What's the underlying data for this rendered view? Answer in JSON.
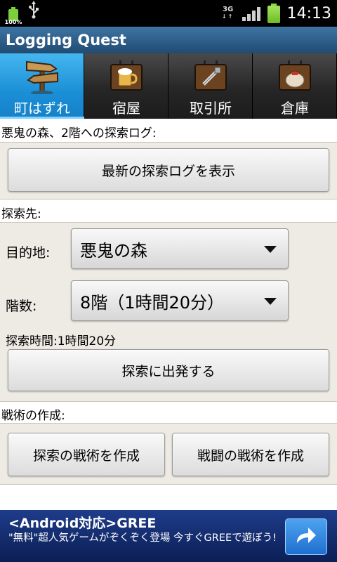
{
  "status_bar": {
    "battery_percent": "100%",
    "network": "3G",
    "time": "14:13",
    "icons": [
      "battery-icon",
      "usb-icon",
      "3g-icon",
      "signal-icon",
      "battery-full-icon"
    ]
  },
  "app": {
    "title": "Logging Quest"
  },
  "tabs": [
    {
      "label": "町はずれ",
      "icon": "signpost-icon",
      "active": true
    },
    {
      "label": "宿屋",
      "icon": "beer-mug-sign-icon",
      "active": false
    },
    {
      "label": "取引所",
      "icon": "trade-sign-icon",
      "active": false
    },
    {
      "label": "倉庫",
      "icon": "bag-sign-icon",
      "active": false
    }
  ],
  "log_section": {
    "label": "悪鬼の森、2階への探索ログ:",
    "show_log_button": "最新の探索ログを表示"
  },
  "explore_section": {
    "label": "探索先:",
    "destination_label": "目的地:",
    "destination_value": "悪鬼の森",
    "floor_label": "階数:",
    "floor_value": "8階（1時間20分）",
    "time_text": "探索時間:1時間20分",
    "depart_button": "探索に出発する"
  },
  "tactics_section": {
    "label": "戦術の作成:",
    "explore_tactics_button": "探索の戦術を作成",
    "battle_tactics_button": "戦闘の戦術を作成"
  },
  "ad": {
    "title": "<Android対応>GREE",
    "text": "\"無料\"超人気ゲームがぞくぞく登場 今すぐGREEで遊ぼう!",
    "button_icon": "arrow-right-icon"
  },
  "colors": {
    "title_bar": "#2c5a86",
    "active_tab": "#1b8fd6",
    "ad_bar": "#132c70",
    "panel": "#eeeae4"
  }
}
